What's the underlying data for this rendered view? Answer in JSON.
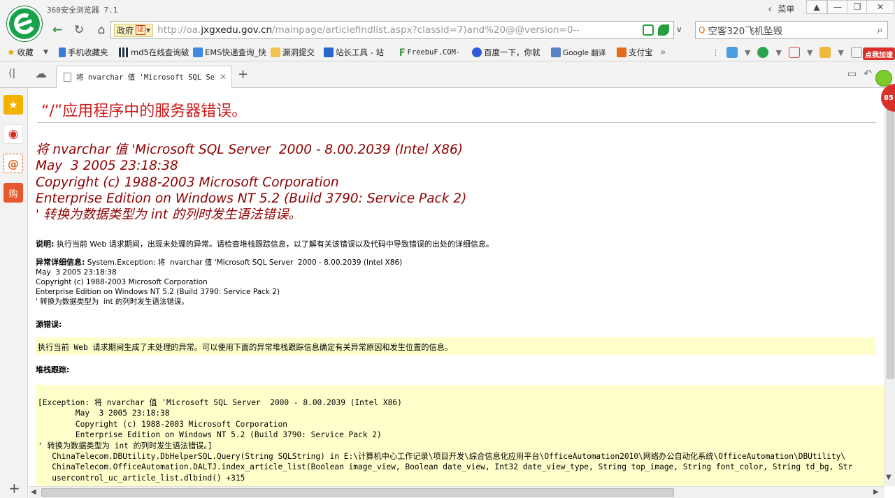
{
  "window": {
    "app_title": "360安全浏览器 7.1",
    "menu_label": "菜单"
  },
  "address_bar": {
    "gov_badge": "政府",
    "gov_badge_verify": "证",
    "url_prefix": "http://oa.",
    "url_host": "jxgxedu.gov.cn",
    "url_path": "/mainpage/articlefindlist.aspx?classid=7)and%20@@version=0--",
    "search_text": "空客320飞机坠毁"
  },
  "bookmarks": {
    "items": [
      {
        "id": "fav",
        "label": "收藏",
        "icon": "star-icon"
      },
      {
        "id": "mobile",
        "label": "手机收藏夹",
        "icon": "phone-icon"
      },
      {
        "id": "md5",
        "label": "md5在线查询破",
        "icon": "qr-icon"
      },
      {
        "id": "ems",
        "label": "EMS快递查询_快",
        "icon": "ems-icon"
      },
      {
        "id": "leak",
        "label": "漏洞提交",
        "icon": "folder-icon"
      },
      {
        "id": "chinaz",
        "label": "站长工具 - 站",
        "icon": "chinaz-icon"
      },
      {
        "id": "freebuf",
        "label": "FreebuF.COM-",
        "icon": "freebuf-icon"
      },
      {
        "id": "baidu",
        "label": "百度一下，你就",
        "icon": "baidu-paw-icon"
      },
      {
        "id": "google",
        "label": "Google 翻译",
        "icon": "google-translate-icon"
      },
      {
        "id": "alipay",
        "label": "支付宝",
        "icon": "alipay-icon"
      }
    ],
    "more": "»",
    "promo": "点我加速"
  },
  "tabs": {
    "active_title": "将 nvarchar 值 'Microsoft SQL Server"
  },
  "page": {
    "title": "“/”应用程序中的服务器错误。",
    "error_heading_lines": [
      "将 nvarchar 值 'Microsoft SQL Server  2000 - 8.00.2039 (Intel X86)",
      "May  3 2005 23:18:38",
      "Copyright (c) 1988-2003 Microsoft Corporation",
      "Enterprise Edition on Windows NT 5.2 (Build 3790: Service Pack 2)",
      "' 转换为数据类型为 int 的列时发生语法错误。"
    ],
    "description_label": "说明:",
    "description_text": " 执行当前 Web 请求期间，出现未处理的异常。请检查堆栈跟踪信息，以了解有关该错误以及代码中导致错误的出处的详细信息。",
    "detail_label": "异常详细信息:",
    "detail_first": " System.Exception: 将  nvarchar 值 'Microsoft SQL Server  2000 - 8.00.2039 (Intel X86)",
    "detail_lines": [
      "May  3 2005 23:18:38",
      "Copyright (c) 1988-2003 Microsoft Corporation",
      "Enterprise Edition on Windows NT 5.2 (Build 3790: Service Pack 2)",
      "' 转换为数据类型为  int 的列时发生语法错误。"
    ],
    "source_label": "源错误:",
    "source_text": "执行当前 Web 请求期间生成了未处理的异常。可以使用下面的异常堆栈跟踪信息确定有关异常原因和发生位置的信息。",
    "stack_label": "堆栈跟踪:",
    "stack_lines": [
      "[Exception: 将 nvarchar 值 'Microsoft SQL Server  2000 - 8.00.2039 (Intel X86)",
      "        May  3 2005 23:18:38",
      "        Copyright (c) 1988-2003 Microsoft Corporation",
      "        Enterprise Edition on Windows NT 5.2 (Build 3790: Service Pack 2)",
      "' 转换为数据类型为 int 的列时发生语法错误。]",
      "   ChinaTelecom.DBUtility.DbHelperSQL.Query(String SQLString) in E:\\计算机中心工作记录\\项目开发\\综合信息化应用平台\\OfficeAutomation2010\\网络办公自动化系统\\OfficeAutomation\\DBUtility\\",
      "   ChinaTelecom.OfficeAutomation.DALTJ.index_article_list(Boolean image_view, Boolean date_view, Int32 date_view_type, String top_image, String font_color, String td_bg, Str",
      "   usercontrol_uc_article_list.dlbind() +315"
    ]
  },
  "side_bubble": "85"
}
